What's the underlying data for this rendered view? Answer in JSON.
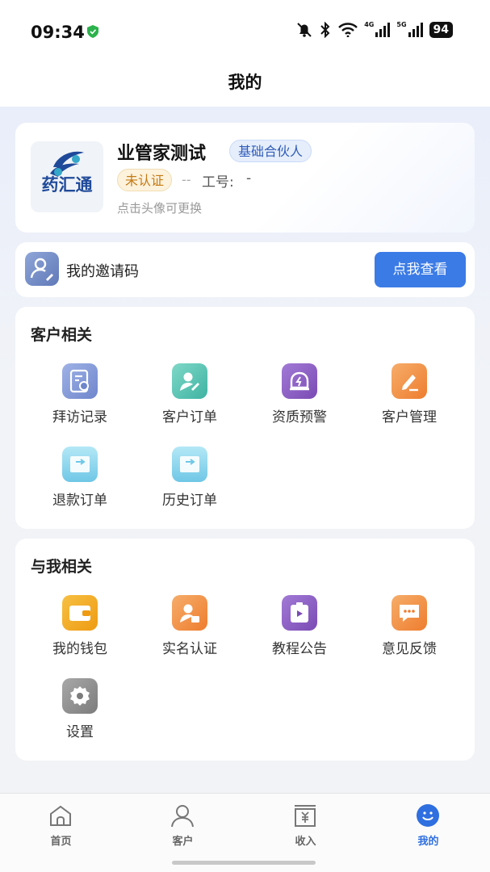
{
  "status_bar": {
    "time": "09:34",
    "net_4g": "4G",
    "net_5g": "5G",
    "battery": "94"
  },
  "header": {
    "title": "我的"
  },
  "profile": {
    "avatar_text": "药汇通",
    "name": "业管家测试",
    "role_badge": "基础合伙人",
    "cert_badge": "未认证",
    "dash": "--",
    "job_label": "工号:",
    "job_value": "-",
    "hint": "点击头像可更换"
  },
  "invite": {
    "label": "我的邀请码",
    "button": "点我查看"
  },
  "customer_section": {
    "title": "客户相关",
    "items": [
      {
        "label": "拜访记录",
        "icon": "visit-record-icon",
        "color": "#7c93d6"
      },
      {
        "label": "客户订单",
        "icon": "customer-order-icon",
        "color": "#4ec0b0"
      },
      {
        "label": "资质预警",
        "icon": "qualification-alert-icon",
        "color": "#8a5bc2"
      },
      {
        "label": "客户管理",
        "icon": "customer-manage-icon",
        "color": "#f08a3c"
      },
      {
        "label": "退款订单",
        "icon": "refund-order-icon",
        "color": "#8fd6ee"
      },
      {
        "label": "历史订单",
        "icon": "history-order-icon",
        "color": "#8fd6ee"
      }
    ]
  },
  "me_section": {
    "title": "与我相关",
    "items": [
      {
        "label": "我的钱包",
        "icon": "wallet-icon",
        "color": "#f0a723"
      },
      {
        "label": "实名认证",
        "icon": "real-name-icon",
        "color": "#f08a3c"
      },
      {
        "label": "教程公告",
        "icon": "tutorial-icon",
        "color": "#8a5bc2"
      },
      {
        "label": "意见反馈",
        "icon": "feedback-icon",
        "color": "#f08a3c"
      },
      {
        "label": "设置",
        "icon": "settings-icon",
        "color": "#8c8c8c"
      }
    ]
  },
  "bottom_nav": {
    "items": [
      {
        "label": "首页",
        "icon": "home-icon"
      },
      {
        "label": "客户",
        "icon": "customer-icon"
      },
      {
        "label": "收入",
        "icon": "income-icon"
      },
      {
        "label": "我的",
        "icon": "me-icon",
        "active": true
      }
    ],
    "active_color": "#2f6fe0"
  }
}
